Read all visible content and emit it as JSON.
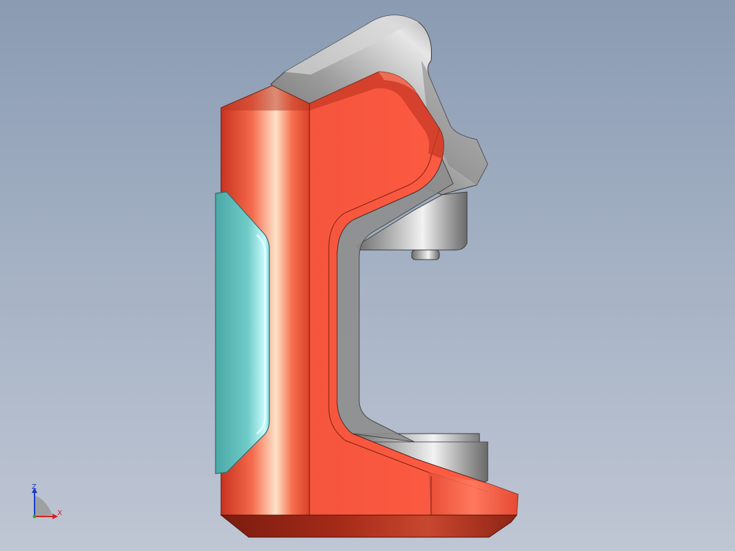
{
  "viewport": {
    "background_top": "#8a9bb2",
    "background_bottom": "#bfc6d4"
  },
  "model": {
    "body_color": "#f2503a",
    "body_highlight": "#ffe2c8",
    "metal_color": "#8c8c8c",
    "window_color": "#6ec8c4"
  },
  "triad": {
    "z_label": "Z",
    "x_label": "X",
    "z_color": "#1a3cc8",
    "x_color": "#d02020"
  }
}
